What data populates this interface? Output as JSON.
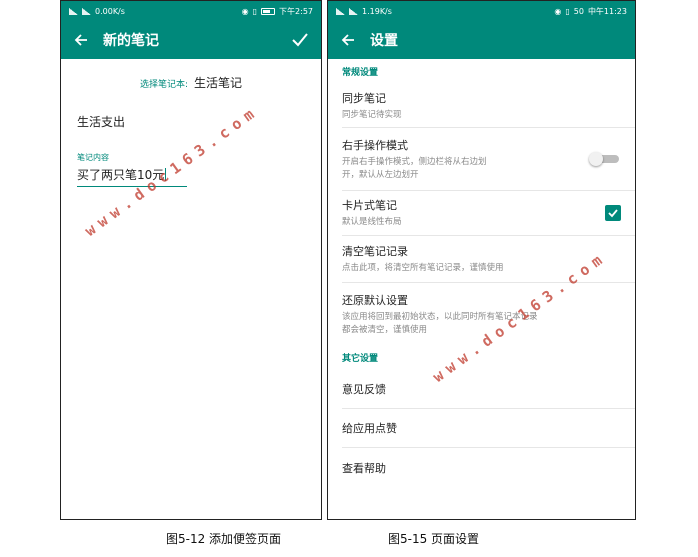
{
  "left_screen": {
    "status_bar": {
      "speed": "0.00K/s",
      "time": "下午2:57"
    },
    "app_bar": {
      "title": "新的笔记",
      "back_icon": "arrow-left-icon",
      "confirm_icon": "check-icon"
    },
    "notebook_label": "选择笔记本:",
    "notebook_value": "生活笔记",
    "note_title": "生活支出",
    "content_label": "笔记内容",
    "content_value": "买了两只笔10元"
  },
  "right_screen": {
    "status_bar": {
      "speed": "1.19K/s",
      "battery": "50",
      "time": "中午11:23"
    },
    "app_bar": {
      "title": "设置",
      "back_icon": "arrow-left-icon"
    },
    "section_general": "常规设置",
    "items": [
      {
        "title": "同步笔记",
        "subtitle": "同步笔记待实现"
      },
      {
        "title": "右手操作模式",
        "subtitle_line1": "开启右手操作模式，侧边栏将从右边划",
        "subtitle_line2": "开，默认从左边划开",
        "toggle_on": false
      },
      {
        "title": "卡片式笔记",
        "subtitle": "默认是线性布局",
        "checked": true
      },
      {
        "title": "清空笔记记录",
        "subtitle": "点击此项，将清空所有笔记记录，谨慎使用"
      },
      {
        "title": "还原默认设置",
        "subtitle_line1": "该应用将回到最初始状态，以此同时所有笔记本记录",
        "subtitle_line2": "都会被清空，谨慎使用"
      }
    ],
    "section_other": "其它设置",
    "other_items": [
      "意见反馈",
      "给应用点赞",
      "查看帮助"
    ]
  },
  "captions": {
    "left": "图5-12 添加便签页面",
    "right": "图5-15 页面设置"
  },
  "watermark": "www.doc163.com",
  "colors": {
    "primary": "#00897b",
    "watermark": "#c0392b"
  }
}
